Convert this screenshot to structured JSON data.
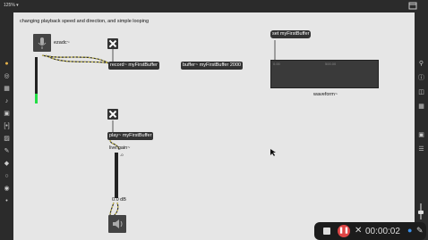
{
  "toolbar": {
    "zoom": "125% ▾"
  },
  "patch": {
    "title_comment": "changing playback speed and direction, and simple looping",
    "adc_label": "ezadc~",
    "record_label": "record~ myFirstBuffer",
    "buffer_label": "buffer~ myFirstBuffer 2000",
    "msg_label": "set myFirstBuffer",
    "waveform_label": "waveform~",
    "waveform_tick_left": "0.00",
    "waveform_tick_right": "500.00",
    "play_label": "play~ myFirstBuffer",
    "live_gain_label": "live.gain~",
    "gain_value": "0.0 dB",
    "gain_scale_top": "-0",
    "adc_meter_level": 0.22
  },
  "recording": {
    "time": "00:00:02"
  },
  "icons": {
    "top_right": "window-icon",
    "left": [
      "palette-icon",
      "target-icon",
      "bar-chart-icon",
      "music-note-icon",
      "image-icon",
      "bracket-icon",
      "tag-icon",
      "puzzle-icon",
      "layers-icon",
      "circle-icon",
      "sliders-icon",
      "dot-icon"
    ],
    "right": [
      "search-icon",
      "info-icon",
      "split-icon",
      "grid-icon",
      "camera-icon",
      "list-icon"
    ]
  }
}
